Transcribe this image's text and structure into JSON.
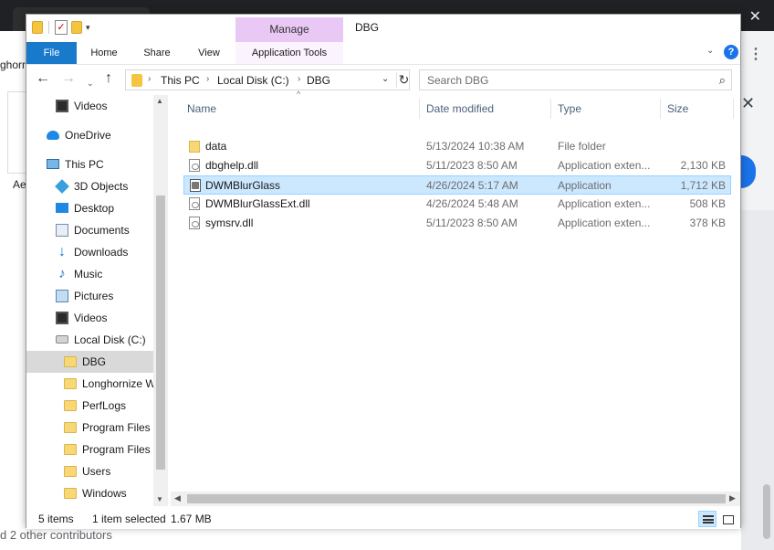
{
  "background": {
    "left_text": "ghorn",
    "left_text2": "Ae",
    "bottom_text": "d 2 other contributors",
    "top_tab_text": "V",
    "close_glyph": "✕"
  },
  "titlebar": {
    "manage_tab": "Manage",
    "title": "DBG"
  },
  "ribbon": {
    "tabs": [
      "File",
      "Home",
      "Share",
      "View",
      "Application Tools"
    ],
    "help": "?"
  },
  "navbar": {
    "back": "←",
    "forward": "→",
    "recent": "⌄",
    "up": "↑",
    "breadcrumbs": [
      "This PC",
      "Local Disk (C:)",
      "DBG"
    ],
    "search_placeholder": "Search DBG"
  },
  "nav_pane": {
    "items": [
      {
        "label": "Videos",
        "icon": "video-icon"
      },
      {
        "label": "OneDrive",
        "icon": "cloud-icon"
      },
      {
        "label": "This PC",
        "icon": "computer-icon"
      },
      {
        "label": "3D Objects",
        "icon": "cube-icon"
      },
      {
        "label": "Desktop",
        "icon": "desktop-icon"
      },
      {
        "label": "Documents",
        "icon": "documents-icon"
      },
      {
        "label": "Downloads",
        "icon": "download-icon"
      },
      {
        "label": "Music",
        "icon": "music-icon"
      },
      {
        "label": "Pictures",
        "icon": "pictures-icon"
      },
      {
        "label": "Videos",
        "icon": "video-icon"
      },
      {
        "label": "Local Disk (C:)",
        "icon": "disk-icon"
      },
      {
        "label": "DBG",
        "icon": "folder-icon",
        "selected": true
      },
      {
        "label": "Longhornize W",
        "icon": "folder-icon"
      },
      {
        "label": "PerfLogs",
        "icon": "folder-icon"
      },
      {
        "label": "Program Files",
        "icon": "folder-icon"
      },
      {
        "label": "Program Files (",
        "icon": "folder-icon"
      },
      {
        "label": "Users",
        "icon": "folder-icon"
      },
      {
        "label": "Windows",
        "icon": "folder-icon"
      }
    ]
  },
  "content": {
    "columns": [
      "Name",
      "Date modified",
      "Type",
      "Size"
    ],
    "files": [
      {
        "name": "data",
        "date": "5/13/2024 10:38 AM",
        "type": "File folder",
        "size": "",
        "icon": "folder-icon"
      },
      {
        "name": "dbghelp.dll",
        "date": "5/11/2023 8:50 AM",
        "type": "Application exten...",
        "size": "2,130 KB",
        "icon": "dll-file-icon"
      },
      {
        "name": "DWMBlurGlass",
        "date": "4/26/2024 5:17 AM",
        "type": "Application",
        "size": "1,712 KB",
        "icon": "application-icon",
        "selected": true
      },
      {
        "name": "DWMBlurGlassExt.dll",
        "date": "4/26/2024 5:48 AM",
        "type": "Application exten...",
        "size": "508 KB",
        "icon": "dll-file-icon"
      },
      {
        "name": "symsrv.dll",
        "date": "5/11/2023 8:50 AM",
        "type": "Application exten...",
        "size": "378 KB",
        "icon": "dll-file-icon"
      }
    ]
  },
  "statusbar": {
    "items_count": "5 items",
    "selection": "1 item selected",
    "selection_size": "1.67 MB"
  },
  "colors": {
    "file_tab": "#1979ca",
    "manage_tab": "#e9c8f5",
    "selection": "#cce8ff",
    "help_button": "#1a73e8"
  }
}
